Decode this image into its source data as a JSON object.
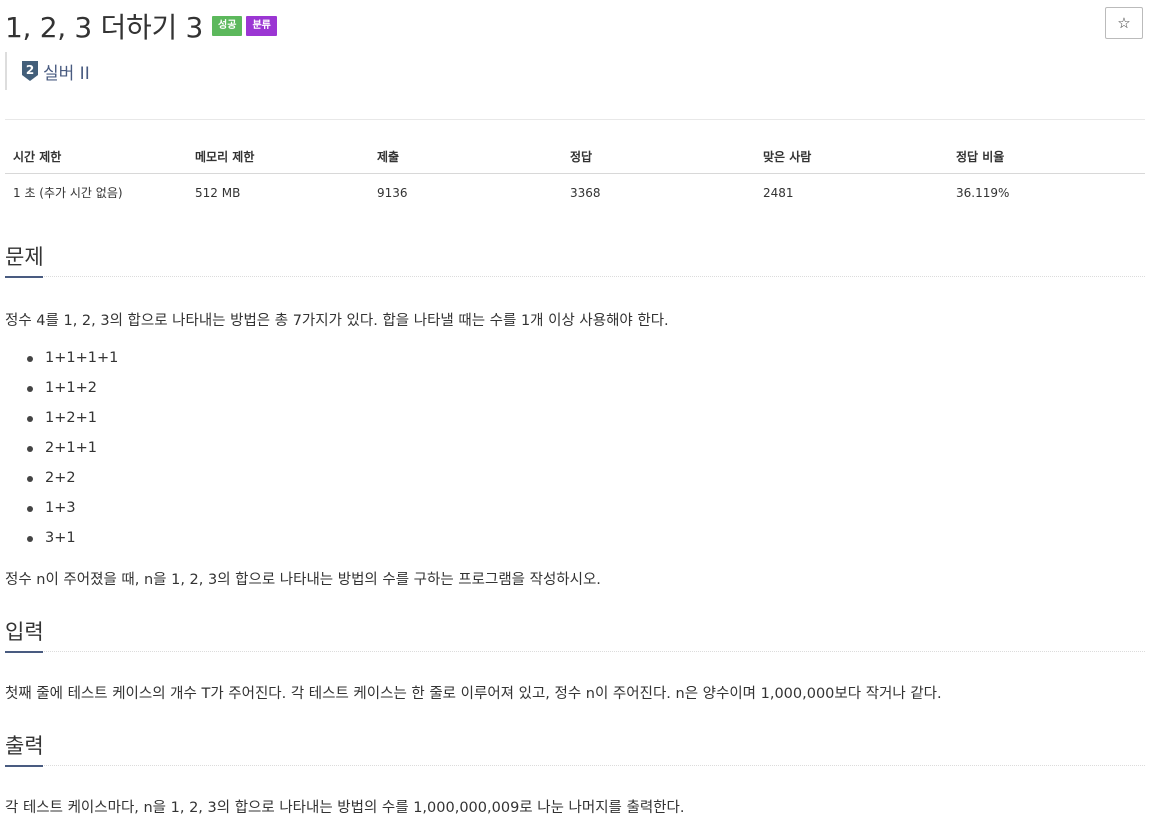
{
  "problem": {
    "title": "1, 2, 3 더하기 3",
    "badges": {
      "success": "성공",
      "category": "분류"
    },
    "star_icon": "☆",
    "tier": {
      "number": "2",
      "label": "실버 II"
    }
  },
  "stats": {
    "headers": [
      "시간 제한",
      "메모리 제한",
      "제출",
      "정답",
      "맞은 사람",
      "정답 비율"
    ],
    "values": [
      "1 초 (추가 시간 없음)",
      "512 MB",
      "9136",
      "3368",
      "2481",
      "36.119%"
    ]
  },
  "sections": {
    "problem": {
      "title": "문제",
      "intro": "정수 4를 1, 2, 3의 합으로 나타내는 방법은 총 7가지가 있다. 합을 나타낼 때는 수를 1개 이상 사용해야 한다.",
      "items": [
        "1+1+1+1",
        "1+1+2",
        "1+2+1",
        "2+1+1",
        "2+2",
        "1+3",
        "3+1"
      ],
      "outro": "정수 n이 주어졌을 때, n을 1, 2, 3의 합으로 나타내는 방법의 수를 구하는 프로그램을 작성하시오."
    },
    "input": {
      "title": "입력",
      "text": "첫째 줄에 테스트 케이스의 개수 T가 주어진다. 각 테스트 케이스는 한 줄로 이루어져 있고, 정수 n이 주어진다. n은 양수이며 1,000,000보다 작거나 같다."
    },
    "output": {
      "title": "출력",
      "text": "각 테스트 케이스마다, n을 1, 2, 3의 합으로 나타내는 방법의 수를 1,000,000,009로 나눈 나머지를 출력한다."
    }
  },
  "colors": {
    "success": "#5cb85c",
    "category": "#9b36d3",
    "tier": "#495b80"
  }
}
